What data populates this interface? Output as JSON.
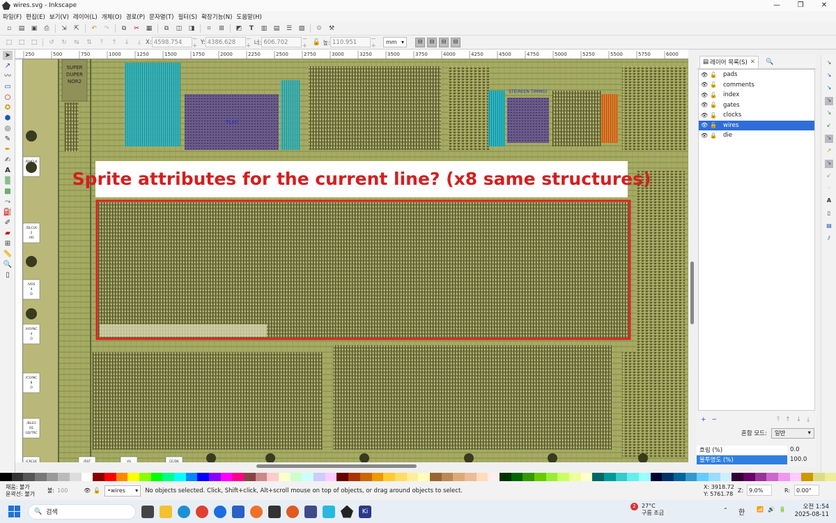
{
  "window": {
    "title": "wires.svg - Inkscape"
  },
  "menu": [
    "파일(F)",
    "편집(E)",
    "보기(V)",
    "레이어(L)",
    "개체(O)",
    "경로(P)",
    "문자열(T)",
    "필터(S)",
    "확장기능(N)",
    "도움말(H)"
  ],
  "toolbar": {
    "x_label": "X:",
    "x_value": "4598.754",
    "y_label": "Y:",
    "y_value": "4386.628",
    "w_label": "너:",
    "w_value": "606.702",
    "h_label": "높:",
    "h_value": "110.951",
    "units": "mm"
  },
  "ruler": {
    "ticks": [
      "250",
      "500",
      "750",
      "1000",
      "1250",
      "1500",
      "1750",
      "2000",
      "2250",
      "2500",
      "2750",
      "3000",
      "3250",
      "3500",
      "3750",
      "4000",
      "4250",
      "4500",
      "4750",
      "5000",
      "5250",
      "5500",
      "5750",
      "6000"
    ]
  },
  "canvas": {
    "annotation": "Sprite attributes for the current line? (x8 same structures)",
    "chip_labels": [
      "SUPER\nDUPER\nNOR2",
      "PLA0",
      "STE(REEN TIMING)"
    ],
    "pads": [
      {
        "label": "/DHCLK\n2\nOD"
      },
      {
        "label": "/DLCLK\n2\nOD"
      },
      {
        "label": "/VDS\n4\nD"
      },
      {
        "label": "/HSYNC\n4\nO"
      },
      {
        "label": "/CSYNC\n8\nO"
      },
      {
        "label": "/BLEO\nOE\nGD/TRC"
      },
      {
        "label": "/CRCLK"
      },
      {
        "label": "/RST"
      },
      {
        "label": "VS"
      },
      {
        "label": "CE/DK"
      }
    ],
    "highlight_color": "#e02020"
  },
  "layers_panel": {
    "tab_label": "레이어 목록(S)",
    "layers": [
      {
        "name": "pads",
        "selected": false
      },
      {
        "name": "comments",
        "selected": false
      },
      {
        "name": "index",
        "selected": false
      },
      {
        "name": "gates",
        "selected": false
      },
      {
        "name": "clocks",
        "selected": false
      },
      {
        "name": "wires",
        "selected": true
      },
      {
        "name": "die",
        "selected": false
      }
    ],
    "blend_label": "혼합 모드:",
    "blend_value": "일반",
    "blur_label": "흐림 (%)",
    "blur_value": "0.0",
    "opacity_label": "불투명도 (%)",
    "opacity_value": "100.0"
  },
  "status": {
    "fill_label": "채움:",
    "fill_value": "불가",
    "stroke_label": "윤곽선:",
    "stroke_value": "불가",
    "opacity_label": "불:",
    "opacity_value": "100",
    "layer": "•wires",
    "message": "No objects selected. Click, Shift+click, Alt+scroll mouse on top of objects, or drag around objects to select.",
    "cursor_x_label": "X:",
    "cursor_x": "3918.72",
    "cursor_y_label": "Y:",
    "cursor_y": "5761.78",
    "zoom_label": "Z:",
    "zoom": "9.0%",
    "rotate_label": "R:",
    "rotate": "0.00°"
  },
  "taskbar": {
    "search_placeholder": "검색",
    "weather_temp": "27°C",
    "weather_desc": "구름 조금",
    "weather_badge": "2",
    "ime": "한",
    "time": "오전 1:54",
    "date": "2025-08-11"
  }
}
